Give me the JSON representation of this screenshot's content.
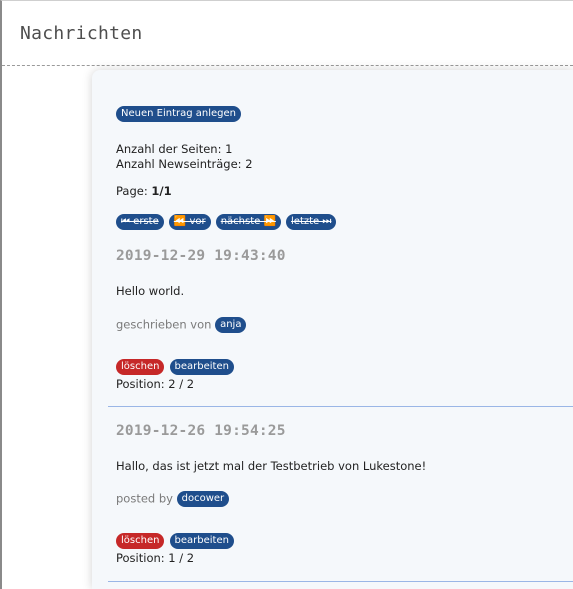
{
  "header": {
    "title": "Nachrichten"
  },
  "toolbar": {
    "new_entry_label": "Neuen Eintrag anlegen"
  },
  "stats": {
    "pages_line": "Anzahl der Seiten: 1",
    "entries_line": "Anzahl Newseinträge: 2"
  },
  "pagination": {
    "label": "Page:",
    "value": "1/1",
    "first": "⏮ erste",
    "prev": "⏪ vor",
    "next": "nächste ⏩",
    "last": "letzte ⏭"
  },
  "entries": [
    {
      "date": "2019-12-29 19:43:40",
      "text": "Hello world.",
      "author_prefix": "geschrieben von",
      "author": "anja",
      "delete_label": "löschen",
      "edit_label": "bearbeiten",
      "position": "Position: 2 / 2"
    },
    {
      "date": "2019-12-26 19:54:25",
      "text": "Hallo, das ist jetzt mal der Testbetrieb von Lukestone!",
      "author_prefix": "posted by",
      "author": "docower",
      "delete_label": "löschen",
      "edit_label": "bearbeiten",
      "position": "Position: 1 / 2"
    }
  ],
  "colors": {
    "pill_blue": "#1f4e8c",
    "pill_red": "#c62828",
    "panel_bg": "#f5f8fb",
    "separator": "#9ab6e6"
  }
}
